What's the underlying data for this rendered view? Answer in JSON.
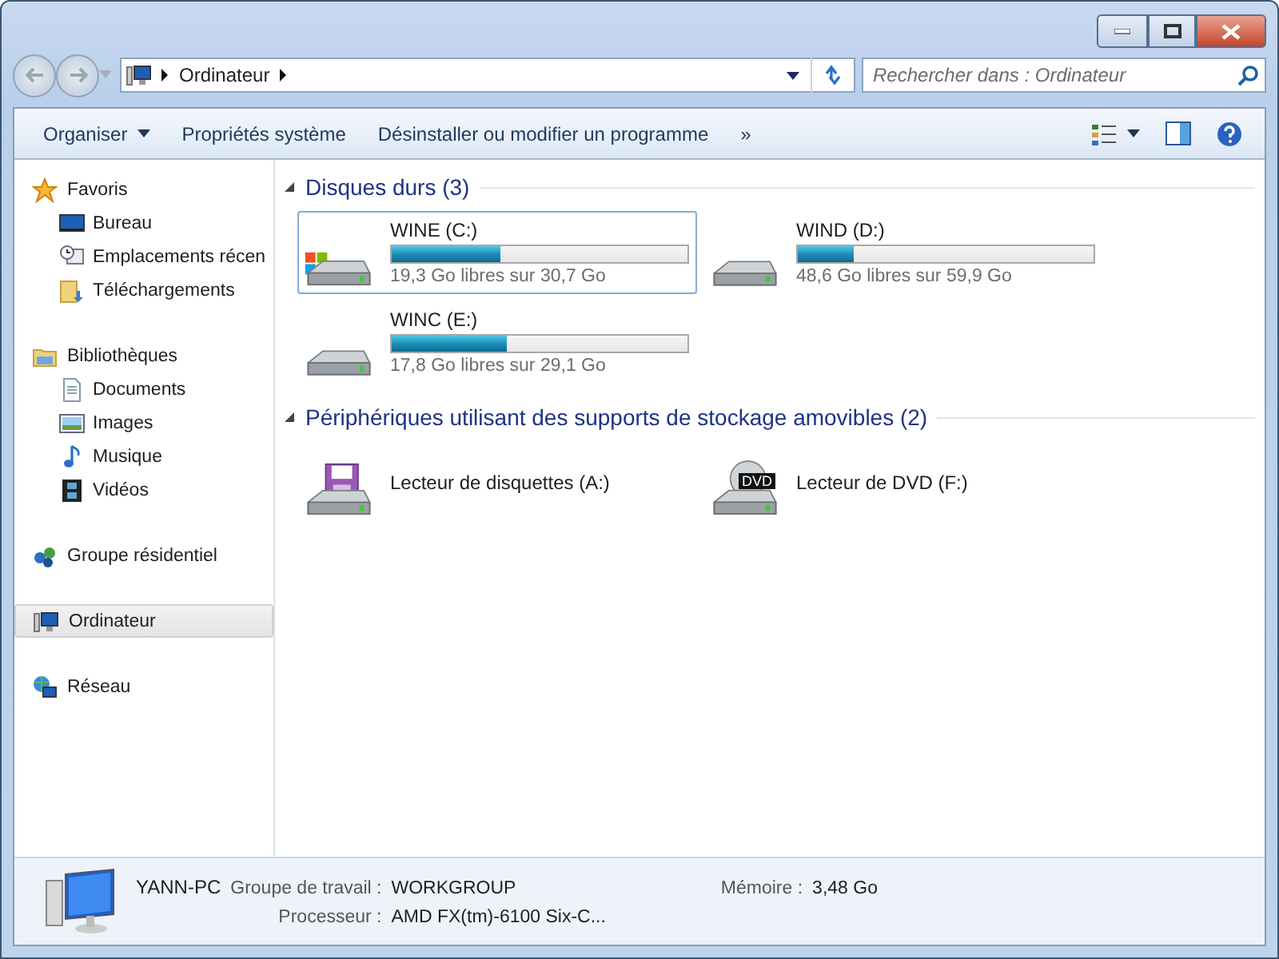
{
  "address": {
    "crumbs": [
      "Ordinateur"
    ]
  },
  "search": {
    "placeholder": "Rechercher dans : Ordinateur"
  },
  "toolbar": [
    {
      "label": "Organiser",
      "kind": "menu"
    },
    {
      "label": "Propriétés système",
      "kind": "plain"
    },
    {
      "label": "Désinstaller ou modifier un programme",
      "kind": "plain"
    },
    {
      "label": "»",
      "kind": "plain"
    }
  ],
  "sidebar": [
    {
      "label": "Favoris",
      "kind": "star",
      "selected": false,
      "children": [
        {
          "label": "Bureau",
          "kind": "desktop"
        },
        {
          "label": "Emplacements récen",
          "kind": "recent"
        },
        {
          "label": "Téléchargements",
          "kind": "download"
        }
      ]
    },
    {
      "label": "Bibliothèques",
      "kind": "library",
      "selected": false,
      "children": [
        {
          "label": "Documents",
          "kind": "document"
        },
        {
          "label": "Images",
          "kind": "image"
        },
        {
          "label": "Musique",
          "kind": "music"
        },
        {
          "label": "Vidéos",
          "kind": "video"
        }
      ]
    },
    {
      "label": "Groupe résidentiel",
      "kind": "homegroup",
      "selected": false
    },
    {
      "label": "Ordinateur",
      "kind": "computer",
      "selected": true
    },
    {
      "label": "Réseau",
      "kind": "network",
      "selected": false
    }
  ],
  "sections": [
    {
      "title": "Disques durs (3)",
      "expanded": true,
      "items": [
        {
          "kind": "system",
          "name": "WINE (C:)",
          "level": 0.37,
          "free": "19,3 Go libres sur 30,7 Go",
          "selected": true
        },
        {
          "kind": "disk",
          "name": "WIND (D:)",
          "level": 0.19,
          "free": "48,6 Go libres sur 59,9 Go",
          "selected": false
        },
        {
          "kind": "disk",
          "name": "WINC (E:)",
          "level": 0.39,
          "free": "17,8 Go libres sur 29,1 Go",
          "selected": false
        }
      ]
    },
    {
      "title": "Périphériques utilisant des supports de stockage amovibles (2)",
      "expanded": true,
      "items": [
        {
          "kind": "floppy",
          "name": "Lecteur de disquettes (A:)",
          "selected": false
        },
        {
          "kind": "dvd",
          "name": "Lecteur de DVD (F:)",
          "badge": "DVD",
          "selected": false
        }
      ]
    }
  ],
  "details": {
    "name": "YANN-PC",
    "fields": [
      {
        "label": "Groupe de travail :",
        "value": "WORKGROUP"
      },
      {
        "label": "Mémoire :",
        "value": "3,48 Go"
      },
      {
        "label": "Processeur :",
        "value": "AMD FX(tm)-6100 Six-C..."
      }
    ]
  }
}
